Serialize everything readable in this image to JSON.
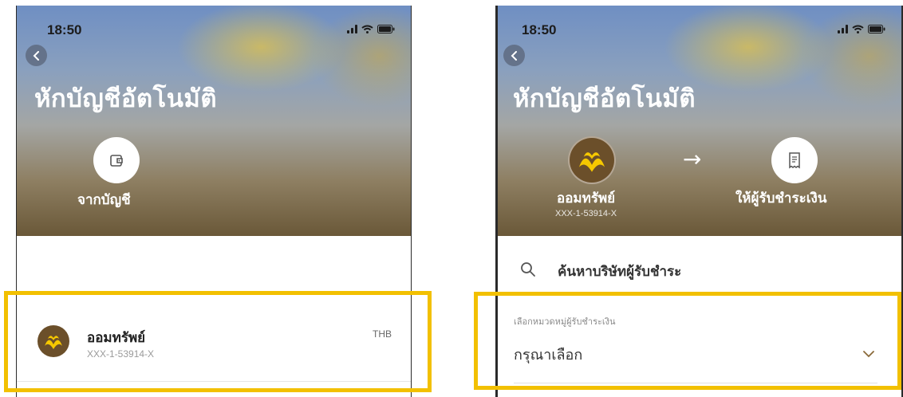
{
  "left": {
    "status": {
      "time": "18:50"
    },
    "header": {
      "title": "หักบัญชีอัตโนมัติ"
    },
    "hero": {
      "from_label": "จากบัญชี",
      "from_icon": "wallet-icon"
    },
    "account": {
      "name": "ออมทรัพย์",
      "number": "XXX-1-53914-X",
      "currency": "THB",
      "logo": "krungsri-bank-logo"
    }
  },
  "right": {
    "status": {
      "time": "18:50"
    },
    "header": {
      "title": "หักบัญชีอัตโนมัติ"
    },
    "hero": {
      "from_label": "ออมทรัพย์",
      "from_number": "XXX-1-53914-X",
      "to_label": "ให้ผู้รับชำระเงิน",
      "to_icon": "receipt-icon",
      "arrow": "→"
    },
    "search": {
      "placeholder": "ค้นหาบริษัทผู้รับชำระ"
    },
    "category": {
      "label": "เลือกหมวดหมู่ผู้รับชำระเงิน",
      "value": "กรุณาเลือก"
    }
  },
  "colors": {
    "highlight": "#f2c000",
    "logo_bg": "#6b4f2a",
    "logo_fg": "#f6c800"
  }
}
